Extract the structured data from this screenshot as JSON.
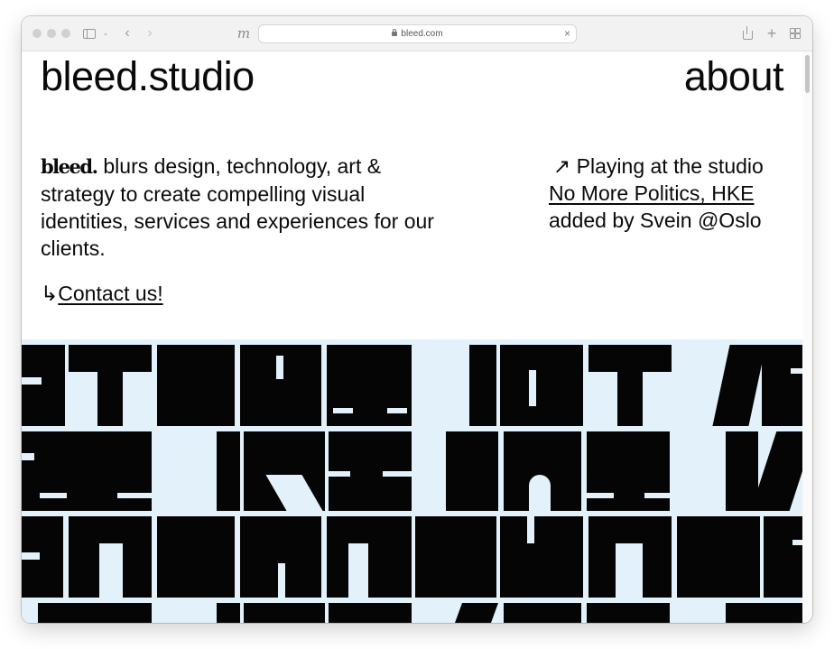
{
  "browser": {
    "url": "bleed.com"
  },
  "site": {
    "title": "bleed.studio",
    "nav_about": "about",
    "wordmark": "bleed.",
    "intro": "blurs design, technology, art & strategy to create compelling visual identities, services and experiences for our clients.",
    "cta_arrow": "↳",
    "cta_label": "Contact us!",
    "now_playing": {
      "arrow": "↗",
      "prefix": "Playing at the studio",
      "track": "No More Politics, HKE",
      "added_by": "added by Svein @Oslo"
    }
  },
  "colors": {
    "pattern_bg": "#e3f1fb",
    "ink": "#050505"
  },
  "icons": {
    "sidebar": "sidebar-icon",
    "back": "chevron-left-icon",
    "forward": "chevron-right-icon",
    "lock": "lock-icon",
    "close": "close-icon",
    "share": "share-icon",
    "new_tab": "plus-icon",
    "tab_overview": "grid-icon"
  }
}
